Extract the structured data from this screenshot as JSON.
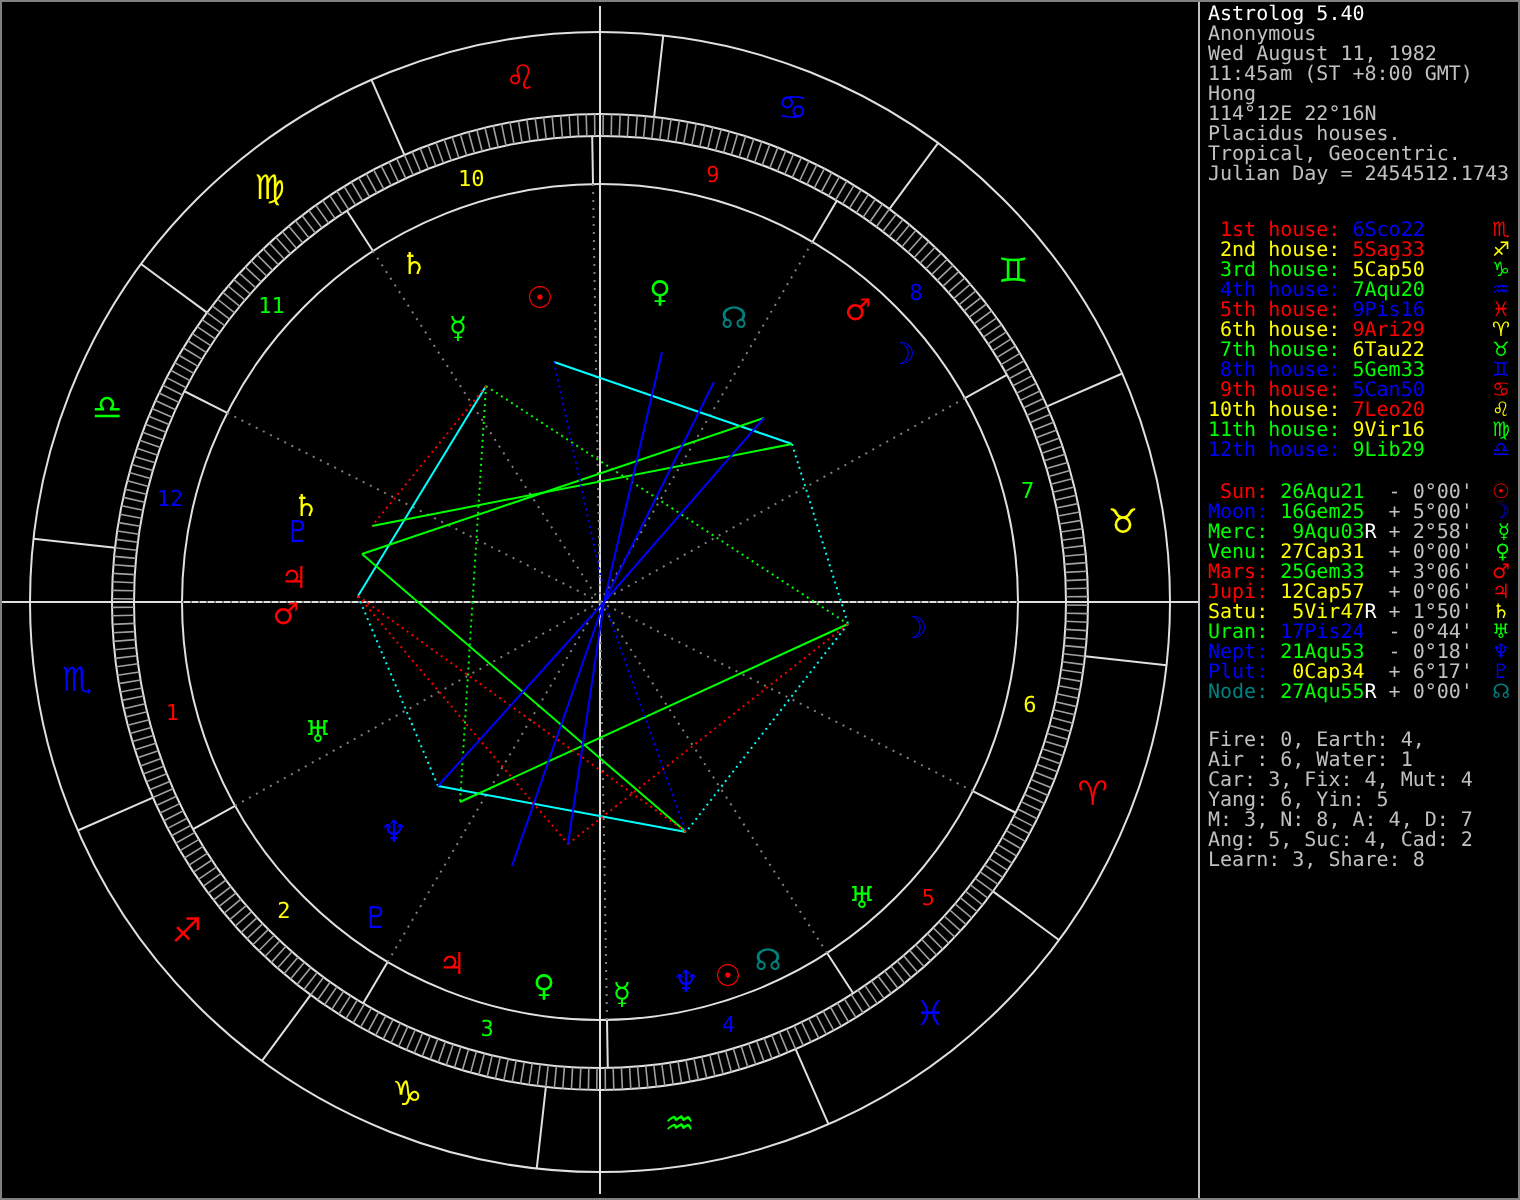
{
  "header": {
    "title": "Astrolog 5.40",
    "lines": [
      "Anonymous",
      "Wed August 11, 1982",
      "11:45am (ST +8:00 GMT)",
      "Hong",
      "114°12E 22°16N",
      "Placidus houses.",
      "Tropical, Geocentric.",
      "Julian Day = 2454512.1743"
    ]
  },
  "houses": [
    {
      "label": {
        "text": "1st house:",
        "color": "#ff0000"
      },
      "cusp": {
        "text": "6Sco22",
        "color": "#0000ff"
      },
      "sign": {
        "glyph": "♏",
        "color": "#ff0000"
      }
    },
    {
      "label": {
        "text": "2nd house:",
        "color": "#ffff00"
      },
      "cusp": {
        "text": "5Sag33",
        "color": "#ff0000"
      },
      "sign": {
        "glyph": "♐",
        "color": "#ffff00"
      }
    },
    {
      "label": {
        "text": "3rd house:",
        "color": "#00ff00"
      },
      "cusp": {
        "text": "5Cap50",
        "color": "#ffff00"
      },
      "sign": {
        "glyph": "♑",
        "color": "#00ff00"
      }
    },
    {
      "label": {
        "text": "4th house:",
        "color": "#0000ff"
      },
      "cusp": {
        "text": "7Aqu20",
        "color": "#00ff00"
      },
      "sign": {
        "glyph": "♒",
        "color": "#0000ff"
      }
    },
    {
      "label": {
        "text": "5th house:",
        "color": "#ff0000"
      },
      "cusp": {
        "text": "9Pis16",
        "color": "#0000ff"
      },
      "sign": {
        "glyph": "♓",
        "color": "#ff0000"
      }
    },
    {
      "label": {
        "text": "6th house:",
        "color": "#ffff00"
      },
      "cusp": {
        "text": "9Ari29",
        "color": "#ff0000"
      },
      "sign": {
        "glyph": "♈",
        "color": "#ffff00"
      }
    },
    {
      "label": {
        "text": "7th house:",
        "color": "#00ff00"
      },
      "cusp": {
        "text": "6Tau22",
        "color": "#ffff00"
      },
      "sign": {
        "glyph": "♉",
        "color": "#00ff00"
      }
    },
    {
      "label": {
        "text": "8th house:",
        "color": "#0000ff"
      },
      "cusp": {
        "text": "5Gem33",
        "color": "#00ff00"
      },
      "sign": {
        "glyph": "♊",
        "color": "#0000ff"
      }
    },
    {
      "label": {
        "text": "9th house:",
        "color": "#ff0000"
      },
      "cusp": {
        "text": "5Can50",
        "color": "#0000ff"
      },
      "sign": {
        "glyph": "♋",
        "color": "#ff0000"
      }
    },
    {
      "label": {
        "text": "10th house:",
        "color": "#ffff00"
      },
      "cusp": {
        "text": "7Leo20",
        "color": "#ff0000"
      },
      "sign": {
        "glyph": "♌",
        "color": "#ffff00"
      }
    },
    {
      "label": {
        "text": "11th house:",
        "color": "#00ff00"
      },
      "cusp": {
        "text": "9Vir16",
        "color": "#ffff00"
      },
      "sign": {
        "glyph": "♍",
        "color": "#00ff00"
      }
    },
    {
      "label": {
        "text": "12th house:",
        "color": "#0000ff"
      },
      "cusp": {
        "text": "9Lib29",
        "color": "#00ff00"
      },
      "sign": {
        "glyph": "♎",
        "color": "#0000ff"
      }
    }
  ],
  "planets": [
    {
      "name": "Sun:",
      "color": "#ff0000",
      "position": {
        "text": "26Aqu21",
        "color": "#00ff00"
      },
      "latitude": "- 0°00'",
      "glyph": "☉"
    },
    {
      "name": "Moon:",
      "color": "#0000ff",
      "position": {
        "text": "16Gem25",
        "color": "#00ff00"
      },
      "latitude": "+ 5°00'",
      "glyph": "☽"
    },
    {
      "name": "Merc:",
      "color": "#00ff00",
      "position": {
        "text": "9Aqu03",
        "color": "#00ff00"
      },
      "retro_mark": "R",
      "latitude": "+ 2°58'",
      "glyph": "☿"
    },
    {
      "name": "Venu:",
      "color": "#00ff00",
      "position": {
        "text": "27Cap31",
        "color": "#ffff00"
      },
      "latitude": "+ 0°00'",
      "glyph": "♀"
    },
    {
      "name": "Mars:",
      "color": "#ff0000",
      "position": {
        "text": "25Gem33",
        "color": "#00ff00"
      },
      "latitude": "+ 3°06'",
      "glyph": "♂"
    },
    {
      "name": "Jupi:",
      "color": "#ff0000",
      "position": {
        "text": "12Cap57",
        "color": "#ffff00"
      },
      "latitude": "+ 0°06'",
      "glyph": "♃"
    },
    {
      "name": "Satu:",
      "color": "#ffff00",
      "position": {
        "text": "5Vir47",
        "color": "#ffff00"
      },
      "retro_mark": "R",
      "latitude": "+ 1°50'",
      "glyph": "♄"
    },
    {
      "name": "Uran:",
      "color": "#00ff00",
      "position": {
        "text": "17Pis24",
        "color": "#0000ff"
      },
      "latitude": "- 0°44'",
      "glyph": "♅"
    },
    {
      "name": "Nept:",
      "color": "#0000ff",
      "position": {
        "text": "21Aqu53",
        "color": "#00ff00"
      },
      "latitude": "- 0°18'",
      "glyph": "♆"
    },
    {
      "name": "Plut:",
      "color": "#0000ff",
      "position": {
        "text": "0Cap34",
        "color": "#ffff00"
      },
      "latitude": "+ 6°17'",
      "glyph": "♇"
    },
    {
      "name": "Node:",
      "color": "#008080",
      "position": {
        "text": "27Aqu55",
        "color": "#00ff00"
      },
      "retro_mark": "R",
      "latitude": "+ 0°00'",
      "glyph": "☊"
    }
  ],
  "stats": [
    "Fire: 0, Earth: 4,",
    "Air : 6, Water: 1",
    "Car: 3, Fix: 4, Mut: 4",
    "Yang: 6, Yin: 5",
    "M: 3, N: 8, A: 4, D: 7",
    "Ang: 5, Suc: 4, Cad: 2",
    "Learn: 3, Share: 8"
  ],
  "wheel": {
    "signs": [
      {
        "glyph": "♈",
        "color": "#ff0000"
      },
      {
        "glyph": "♉",
        "color": "#ffff00"
      },
      {
        "glyph": "♊",
        "color": "#00ff00"
      },
      {
        "glyph": "♋",
        "color": "#0000ff"
      },
      {
        "glyph": "♌",
        "color": "#ff0000"
      },
      {
        "glyph": "♍",
        "color": "#ffff00"
      },
      {
        "glyph": "♎",
        "color": "#00ff00"
      },
      {
        "glyph": "♏",
        "color": "#0000ff"
      },
      {
        "glyph": "♐",
        "color": "#ff0000"
      },
      {
        "glyph": "♑",
        "color": "#ffff00"
      },
      {
        "glyph": "♒",
        "color": "#00ff00"
      },
      {
        "glyph": "♓",
        "color": "#0000ff"
      }
    ],
    "house_numbers": [
      {
        "label": "1",
        "color": "#ff0000"
      },
      {
        "label": "2",
        "color": "#ffff00"
      },
      {
        "label": "3",
        "color": "#00ff00"
      },
      {
        "label": "4",
        "color": "#0000ff"
      },
      {
        "label": "5",
        "color": "#ff0000"
      },
      {
        "label": "6",
        "color": "#ffff00"
      },
      {
        "label": "7",
        "color": "#00ff00"
      },
      {
        "label": "8",
        "color": "#0000ff"
      },
      {
        "label": "9",
        "color": "#ff0000"
      },
      {
        "label": "10",
        "color": "#ffff00"
      },
      {
        "label": "11",
        "color": "#00ff00"
      },
      {
        "label": "12",
        "color": "#0000ff"
      }
    ],
    "planets": [
      {
        "glyph": "♄",
        "color": "#ffff00"
      },
      {
        "glyph": "☿",
        "color": "#00ff00"
      },
      {
        "glyph": "☉",
        "color": "#ff0000"
      },
      {
        "glyph": "♀",
        "color": "#00ff00"
      },
      {
        "glyph": "☊",
        "color": "#008080"
      },
      {
        "glyph": "♂",
        "color": "#ff0000"
      },
      {
        "glyph": "☽",
        "color": "#0000ff"
      },
      {
        "glyph": "♄",
        "color": "#ffff00"
      },
      {
        "glyph": "♇",
        "color": "#0000ff"
      },
      {
        "glyph": "♃",
        "color": "#ff0000"
      },
      {
        "glyph": "♂",
        "color": "#ff0000"
      },
      {
        "glyph": "♅",
        "color": "#00ff00"
      },
      {
        "glyph": "☽",
        "color": "#0000ff"
      },
      {
        "glyph": "♆",
        "color": "#0000ff"
      },
      {
        "glyph": "♇",
        "color": "#0000ff"
      },
      {
        "glyph": "♃",
        "color": "#ff0000"
      },
      {
        "glyph": "♀",
        "color": "#00ff00"
      },
      {
        "glyph": "☿",
        "color": "#00ff00"
      },
      {
        "glyph": "♆",
        "color": "#0000ff"
      },
      {
        "glyph": "☉",
        "color": "#ff0000"
      },
      {
        "glyph": "☊",
        "color": "#008080"
      },
      {
        "glyph": "♅",
        "color": "#00ff00"
      }
    ]
  }
}
